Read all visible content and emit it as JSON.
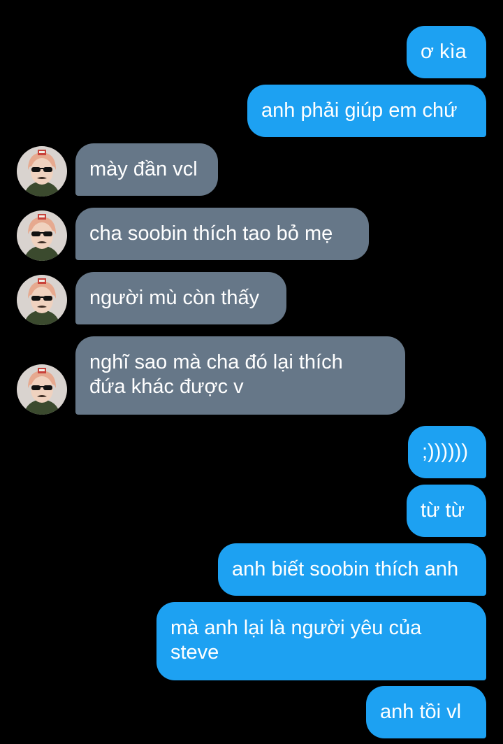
{
  "conversation": {
    "messages": [
      {
        "side": "out",
        "text": "ơ kìa"
      },
      {
        "side": "out",
        "text": "anh phải giúp em chứ"
      },
      {
        "side": "in",
        "text": "mày đần vcl",
        "avatar": "user-avatar"
      },
      {
        "side": "in",
        "text": "cha soobin thích tao bỏ mẹ",
        "avatar": "user-avatar"
      },
      {
        "side": "in",
        "text": "người mù còn thấy",
        "avatar": "user-avatar"
      },
      {
        "side": "in",
        "text": "nghĩ sao mà cha đó lại thích\nđứa khác được v",
        "avatar": "user-avatar"
      },
      {
        "side": "out",
        "text": ";))))))"
      },
      {
        "side": "out",
        "text": "từ từ"
      },
      {
        "side": "out",
        "text": "anh biết soobin thích anh"
      },
      {
        "side": "out",
        "text": "mà anh lại là người yêu của\nsteve"
      },
      {
        "side": "out",
        "text": "anh tồi vl"
      }
    ]
  },
  "colors": {
    "background": "#000000",
    "outgoing_bubble": "#1da1f2",
    "incoming_bubble": "#667788",
    "text": "#ffffff"
  }
}
